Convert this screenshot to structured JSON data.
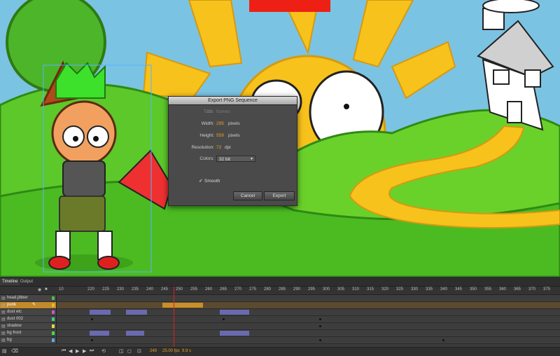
{
  "dialog": {
    "title": "Export PNG Sequence",
    "total_label": "Total:",
    "total_value": "22",
    "total_unit": "frames",
    "width_label": "Width:",
    "width_value": "295",
    "width_unit": "pixels",
    "height_label": "Height:",
    "height_value": "559",
    "height_unit": "pixels",
    "resolution_label": "Resolution:",
    "resolution_value": "72",
    "resolution_unit": "dpi",
    "colors_label": "Colors:",
    "colors_value": "32 bit",
    "smooth_label": "Smooth",
    "cancel_label": "Cancel",
    "export_label": "Export"
  },
  "timeline": {
    "tabs": [
      {
        "label": "Timeline"
      },
      {
        "label": "Output"
      }
    ],
    "ruler": [
      "10",
      "220",
      "225",
      "230",
      "235",
      "240",
      "245",
      "250",
      "255",
      "260",
      "265",
      "270",
      "275",
      "280",
      "285",
      "290",
      "295",
      "300",
      "305",
      "310",
      "315",
      "320",
      "325",
      "330",
      "335",
      "340",
      "345",
      "350",
      "355",
      "360",
      "365",
      "370",
      "375"
    ],
    "layers": [
      {
        "name": "head.jibber",
        "color": "#55bb44"
      },
      {
        "name": "punk",
        "color": "#e8b830"
      },
      {
        "name": "dust etc",
        "color": "#cc55cc"
      },
      {
        "name": "dust 002",
        "color": "#44cc88"
      },
      {
        "name": "shadow",
        "color": "#dddd44"
      },
      {
        "name": "bg front",
        "color": "#44dd44"
      },
      {
        "name": "bg",
        "color": "#55aaee"
      }
    ],
    "frame_current": "249",
    "fps": "25.00 fps",
    "elapsed": "9.9 s"
  },
  "colors": {
    "accent_orange": "#f0a020",
    "playhead": "#e0201c",
    "sky": "#6fb6d8",
    "grass": "#6ad12a",
    "sun": "#f8c21c"
  }
}
